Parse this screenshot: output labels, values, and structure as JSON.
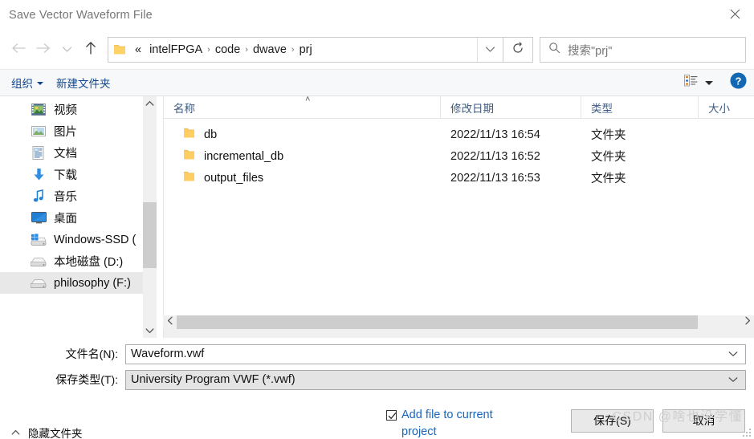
{
  "window": {
    "title": "Save Vector Waveform File",
    "close_icon": "close-icon"
  },
  "nav": {
    "back_icon": "arrow-left-icon",
    "forward_icon": "arrow-right-icon",
    "recent_icon": "chevron-down-icon",
    "up_icon": "arrow-up-icon",
    "address": {
      "folder_icon": "folder-icon",
      "overflow": "«",
      "crumbs": [
        "intelFPGA",
        "code",
        "dwave",
        "prj"
      ],
      "separator": "›",
      "dropdown_icon": "chevron-down-icon"
    },
    "refresh_icon": "refresh-icon",
    "search": {
      "icon": "search-icon",
      "placeholder": "搜索\"prj\"",
      "value": ""
    }
  },
  "commandbar": {
    "organize_label": "组织",
    "new_folder_label": "新建文件夹",
    "view_icon": "list-view-icon",
    "view_caret_icon": "caret-down-icon",
    "help_icon": "help-icon",
    "help_label": "?"
  },
  "sidebar": {
    "items": [
      {
        "label": "视频",
        "icon": "videos-icon",
        "selected": false
      },
      {
        "label": "图片",
        "icon": "pictures-icon",
        "selected": false
      },
      {
        "label": "文档",
        "icon": "documents-icon",
        "selected": false
      },
      {
        "label": "下载",
        "icon": "downloads-icon",
        "selected": false
      },
      {
        "label": "音乐",
        "icon": "music-icon",
        "selected": false
      },
      {
        "label": "桌面",
        "icon": "desktop-icon",
        "selected": false
      },
      {
        "label": "Windows-SSD (",
        "icon": "windows-drive-icon",
        "selected": false
      },
      {
        "label": "本地磁盘 (D:)",
        "icon": "drive-icon",
        "selected": false
      },
      {
        "label": "philosophy (F:)",
        "icon": "drive-icon",
        "selected": true
      }
    ],
    "scroll_up_icon": "chevron-up-icon",
    "scroll_down_icon": "chevron-down-icon"
  },
  "filelist": {
    "columns": [
      {
        "label": "名称",
        "key": "name"
      },
      {
        "label": "修改日期",
        "key": "date"
      },
      {
        "label": "类型",
        "key": "type"
      },
      {
        "label": "大小",
        "key": "size"
      }
    ],
    "sort_indicator": "˄",
    "rows": [
      {
        "icon": "folder-icon",
        "name": "db",
        "date": "2022/11/13 16:54",
        "type": "文件夹",
        "size": ""
      },
      {
        "icon": "folder-icon",
        "name": "incremental_db",
        "date": "2022/11/13 16:52",
        "type": "文件夹",
        "size": ""
      },
      {
        "icon": "folder-icon",
        "name": "output_files",
        "date": "2022/11/13 16:53",
        "type": "文件夹",
        "size": ""
      }
    ],
    "scroll_left_icon": "chevron-left-icon",
    "scroll_right_icon": "chevron-right-icon"
  },
  "form": {
    "filename_label": "文件名(N):",
    "filename_value": "Waveform.vwf",
    "filename_dropdown_icon": "chevron-down-icon",
    "filetype_label": "保存类型(T):",
    "filetype_value": "University Program VWF (*.vwf)",
    "filetype_dropdown_icon": "chevron-down-icon"
  },
  "footer": {
    "hide_folders_label": "隐藏文件夹",
    "hide_folders_icon": "chevron-up-icon",
    "add_to_project_label": "Add file to current project",
    "add_to_project_checked": true,
    "save_label": "保存(S)",
    "cancel_label": "取消",
    "watermark": "CSDN @啥也没学懂",
    "resize_grip_icon": "resize-grip-icon"
  },
  "colors": {
    "link_blue": "#10478f",
    "checkbox_label_blue": "#1566c0",
    "column_header_blue": "#3f5b82",
    "folder_yellow": "#ffc95b",
    "selection_gray": "#e8e8e8"
  }
}
